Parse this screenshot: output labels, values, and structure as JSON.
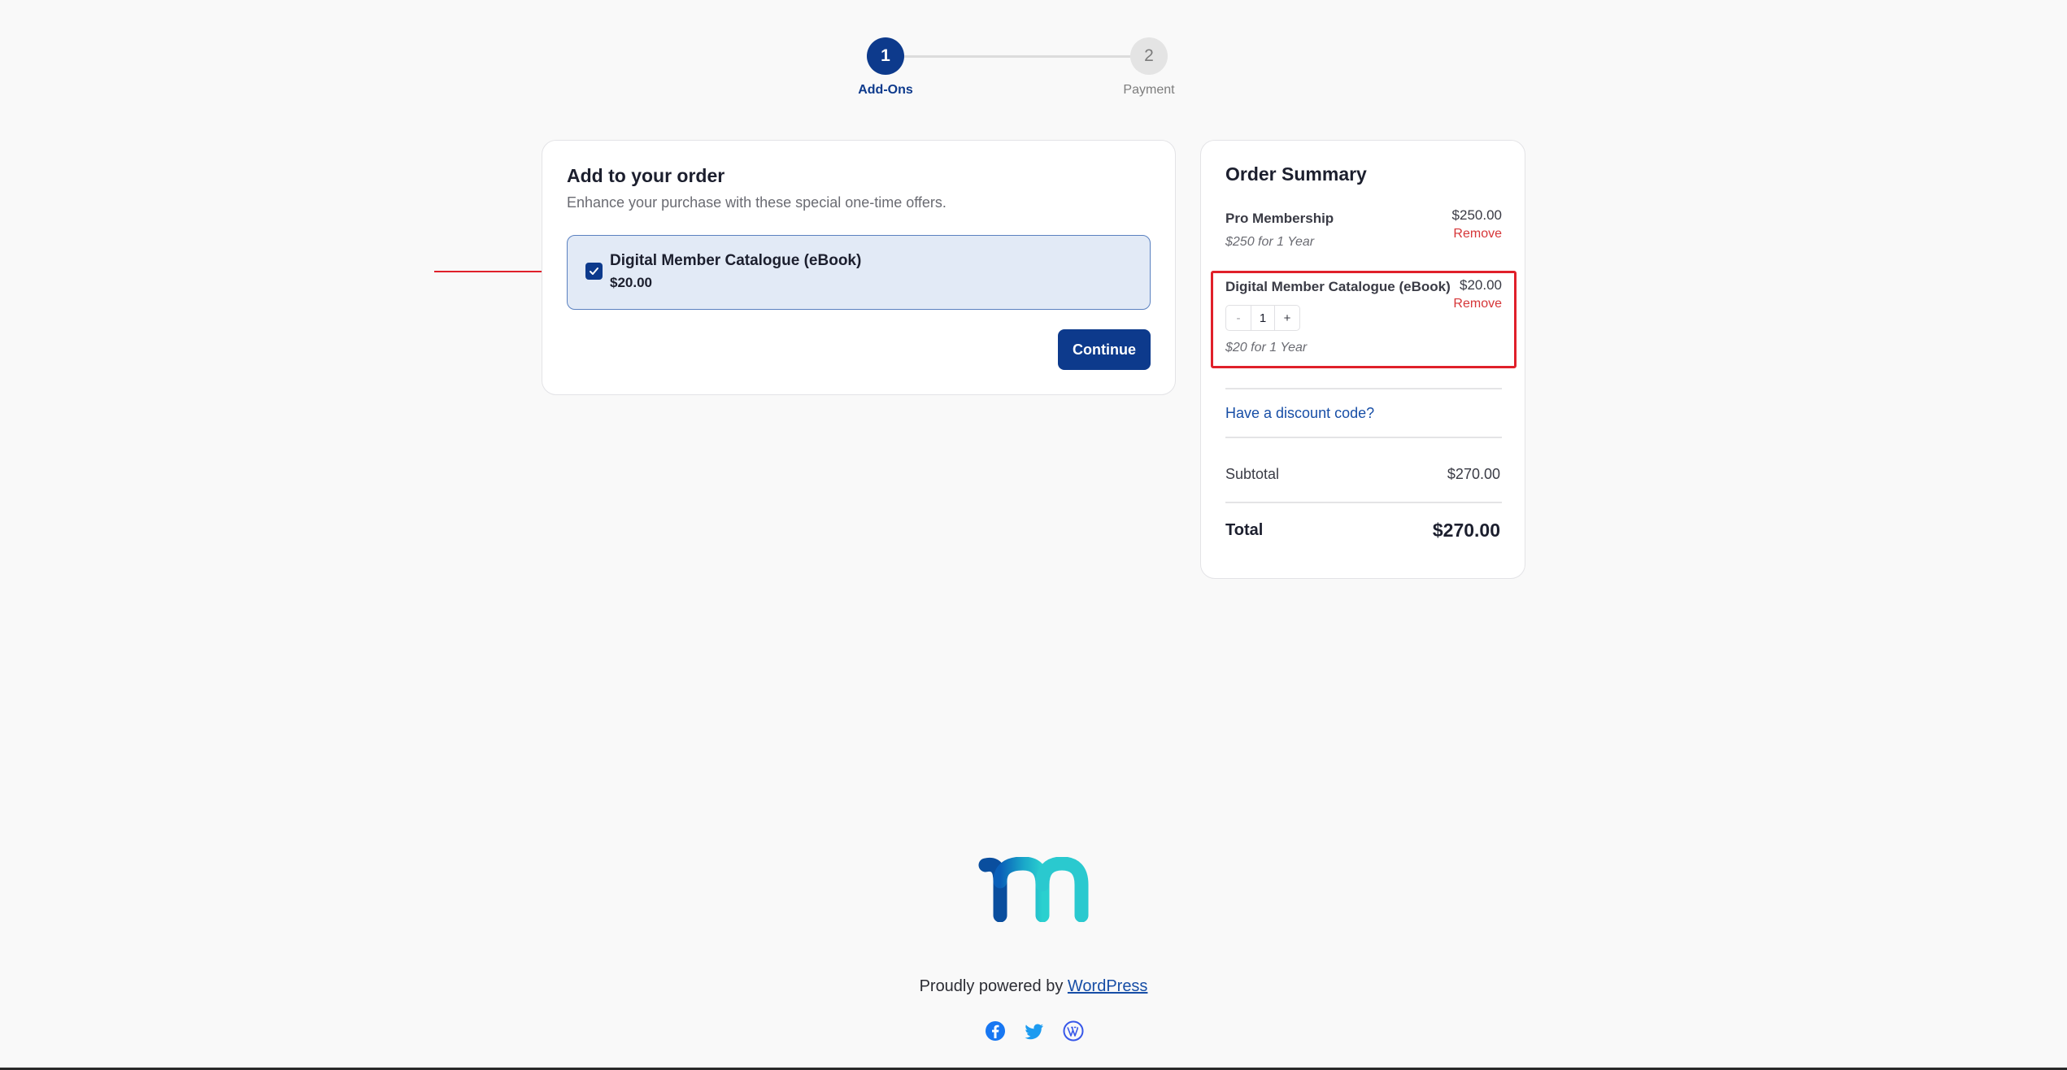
{
  "stepper": {
    "steps": [
      {
        "number": "1",
        "label": "Add-Ons",
        "active": true
      },
      {
        "number": "2",
        "label": "Payment",
        "active": false
      }
    ]
  },
  "addons": {
    "title": "Add to your order",
    "subtitle": "Enhance your purchase with these special one-time offers.",
    "item": {
      "name": "Digital Member Catalogue (eBook)",
      "price": "$20.00",
      "checked": true
    },
    "continue_label": "Continue"
  },
  "summary": {
    "title": "Order Summary",
    "items": [
      {
        "name": "Pro Membership",
        "price": "$250.00",
        "remove": "Remove",
        "period": "$250 for 1 Year"
      },
      {
        "name": "Digital Member Catalogue (eBook)",
        "price": "$20.00",
        "remove": "Remove",
        "period": "$20 for 1 Year",
        "quantity": "1",
        "qty_minus": "-",
        "qty_plus": "+"
      }
    ],
    "discount_link": "Have a discount code?",
    "subtotal_label": "Subtotal",
    "subtotal_value": "$270.00",
    "total_label": "Total",
    "total_value": "$270.00"
  },
  "footer": {
    "powered_prefix": "Proudly powered by ",
    "powered_link": "WordPress",
    "social_icons": [
      "facebook-icon",
      "twitter-icon",
      "wordpress-icon"
    ]
  },
  "colors": {
    "primary": "#0d3a8c",
    "link": "#174ea6",
    "danger": "#d63638",
    "highlight": "#e0202a",
    "addon_bg": "#e2eaf6",
    "page_bg": "#f9f9f9"
  },
  "icons": {
    "checkbox": "check-icon",
    "annotation": "red-arrow-icon",
    "logo": "brand-logo"
  }
}
